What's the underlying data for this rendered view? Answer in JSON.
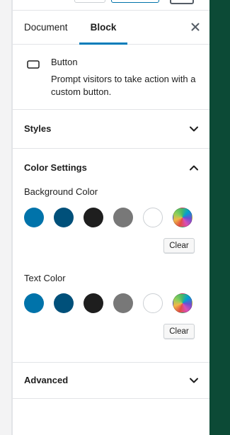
{
  "tabs": {
    "document_label": "Document",
    "block_label": "Block",
    "active": "Block"
  },
  "block_card": {
    "icon": "button-block-icon",
    "title": "Button",
    "description": "Prompt visitors to take action with a custom button."
  },
  "panels": {
    "styles": {
      "title": "Styles",
      "expanded": false
    },
    "color_settings": {
      "title": "Color Settings",
      "expanded": true,
      "background": {
        "label": "Background Color",
        "clear_label": "Clear",
        "swatches": [
          "#0073aa",
          "#00507a",
          "#1e1e1e",
          "#787878",
          "#ffffff",
          "gradient"
        ]
      },
      "text": {
        "label": "Text Color",
        "clear_label": "Clear",
        "swatches": [
          "#0073aa",
          "#00507a",
          "#1e1e1e",
          "#787878",
          "#ffffff",
          "gradient"
        ]
      }
    },
    "advanced": {
      "title": "Advanced",
      "expanded": false
    }
  },
  "colors": {
    "accent": "#007cba",
    "right_strip": "#0c4a36",
    "border": "#e2e4e7"
  }
}
